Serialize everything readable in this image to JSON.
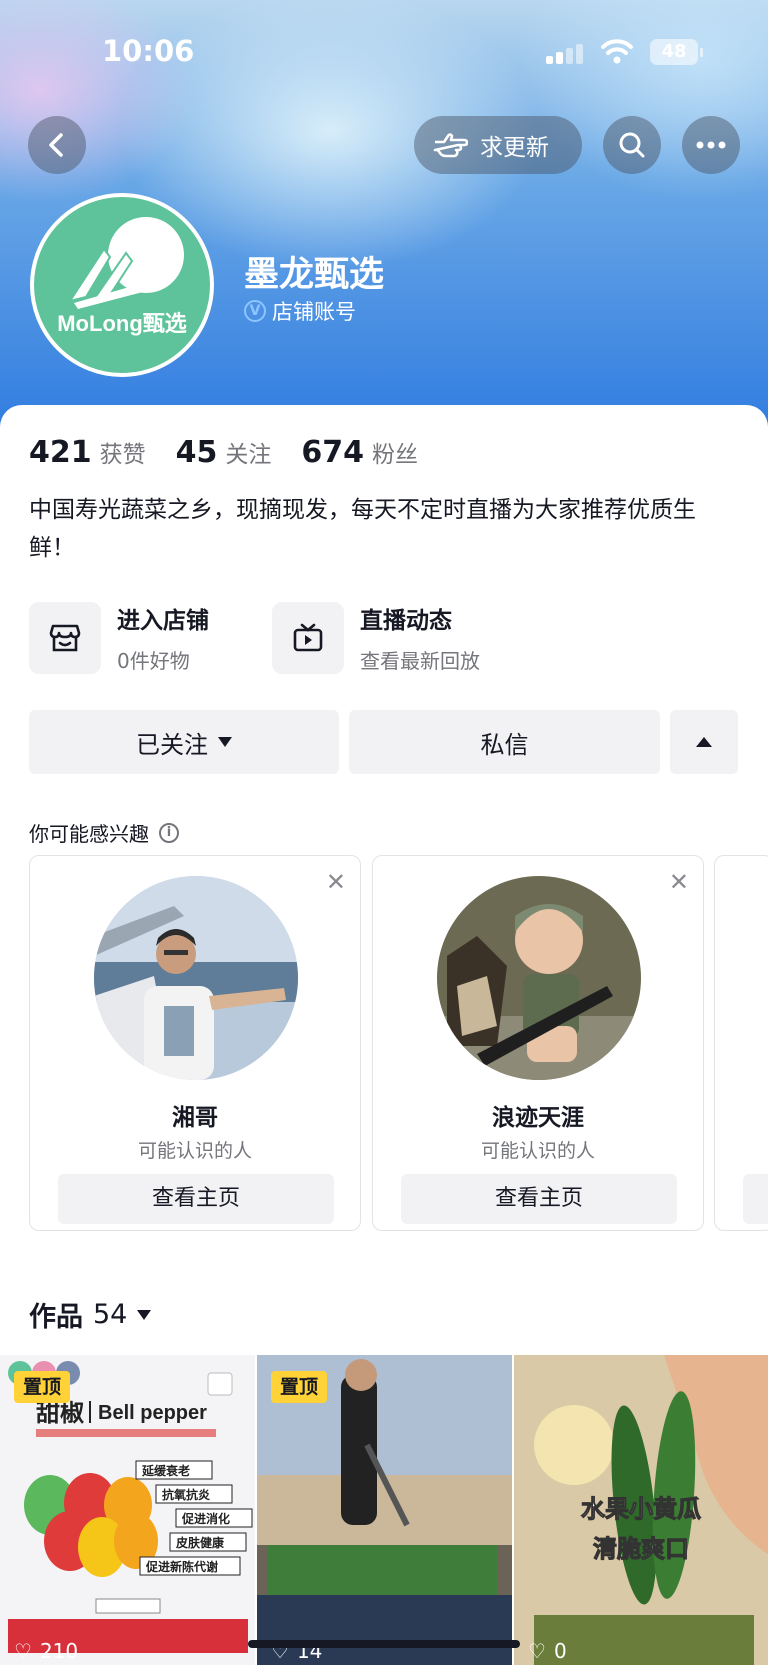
{
  "status_bar": {
    "time": "10:06",
    "battery": "48"
  },
  "header": {
    "update_label": "求更新",
    "shop_name": "墨龙甄选",
    "verified_label": "店铺账号",
    "avatar_logo_text": "MoLong甄选"
  },
  "stats": [
    {
      "value": "421",
      "label": "获赞"
    },
    {
      "value": "45",
      "label": "关注"
    },
    {
      "value": "674",
      "label": "粉丝"
    }
  ],
  "bio": "中国寿光蔬菜之乡，现摘现发，每天不定时直播为大家推荐优质生鲜！",
  "entries": [
    {
      "title": "进入店铺",
      "subtitle": "0件好物",
      "icon": "store-icon"
    },
    {
      "title": "直播动态",
      "subtitle": "查看最新回放",
      "icon": "tv-icon"
    }
  ],
  "actions": {
    "follow_label": "已关注",
    "message_label": "私信"
  },
  "suggestions": {
    "title": "你可能感兴趣",
    "items": [
      {
        "name": "湘哥",
        "subtitle": "可能认识的人",
        "button": "查看主页"
      },
      {
        "name": "浪迹天涯",
        "subtitle": "可能认识的人",
        "button": "查看主页"
      }
    ]
  },
  "works": {
    "label": "作品",
    "count": "54",
    "tiles": [
      {
        "pinned": "置顶",
        "likes": "210",
        "title": "甜椒",
        "subtitle": "Bell pepper",
        "caption_lines": [
          "延缓衰老",
          "抗氧抗炎",
          "促进消化",
          "皮肤健康",
          "促进新陈代谢"
        ]
      },
      {
        "pinned": "置顶",
        "likes": "14"
      },
      {
        "likes": "0",
        "caption_lines": [
          "水果小黄瓜",
          "清脆爽口"
        ]
      }
    ]
  },
  "colors": {
    "accent_blue": "#2f7be0",
    "pin_yellow": "#ffd337",
    "avatar_green": "#5ec39a"
  }
}
